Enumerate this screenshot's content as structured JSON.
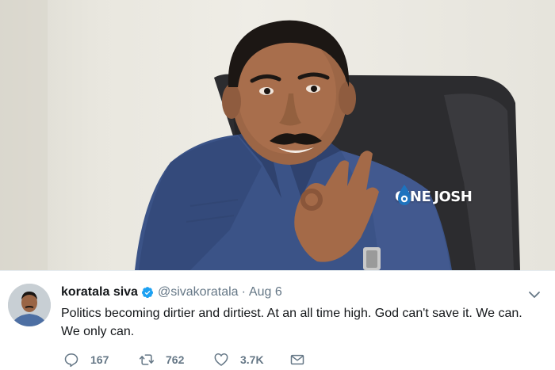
{
  "photo": {
    "watermark": {
      "left": "CINE",
      "right": "JOSH"
    }
  },
  "tweet": {
    "display_name": "koratala siva",
    "verified": true,
    "handle": "@sivakoratala",
    "separator": "·",
    "date": "Aug 6",
    "text": "Politics becoming dirtier and dirtiest. At an all time high. God can't save it. We can. We only can.",
    "actions": {
      "replies": "167",
      "retweets": "762",
      "likes": "3.7K"
    }
  },
  "icons": {
    "verified": "verified-badge-icon",
    "caret": "chevron-down-icon",
    "reply": "reply-icon",
    "retweet": "retweet-icon",
    "like": "heart-icon",
    "message": "envelope-icon"
  },
  "colors": {
    "verified_blue": "#1da1f2",
    "text_primary": "#14171a",
    "text_secondary": "#657786",
    "shirt_blue": "#3c5487",
    "chair": "#2b2b2d",
    "watermark_accent": "#1e73be"
  }
}
